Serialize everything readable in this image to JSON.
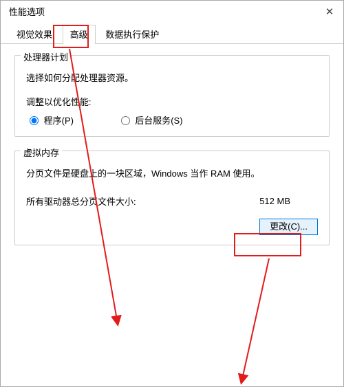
{
  "dialog": {
    "title": "性能选项",
    "close": "✕"
  },
  "tabs": {
    "visual": "视觉效果",
    "advanced": "高级",
    "dep": "数据执行保护"
  },
  "processor": {
    "legend": "处理器计划",
    "desc": "选择如何分配处理器资源。",
    "adjust": "调整以优化性能:",
    "programs": "程序(P)",
    "background": "后台服务(S)"
  },
  "vmem": {
    "legend": "虚拟内存",
    "desc": "分页文件是硬盘上的一块区域，Windows 当作 RAM 使用。",
    "total_label": "所有驱动器总分页文件大小:",
    "total_value": "512 MB",
    "change": "更改(C)..."
  }
}
